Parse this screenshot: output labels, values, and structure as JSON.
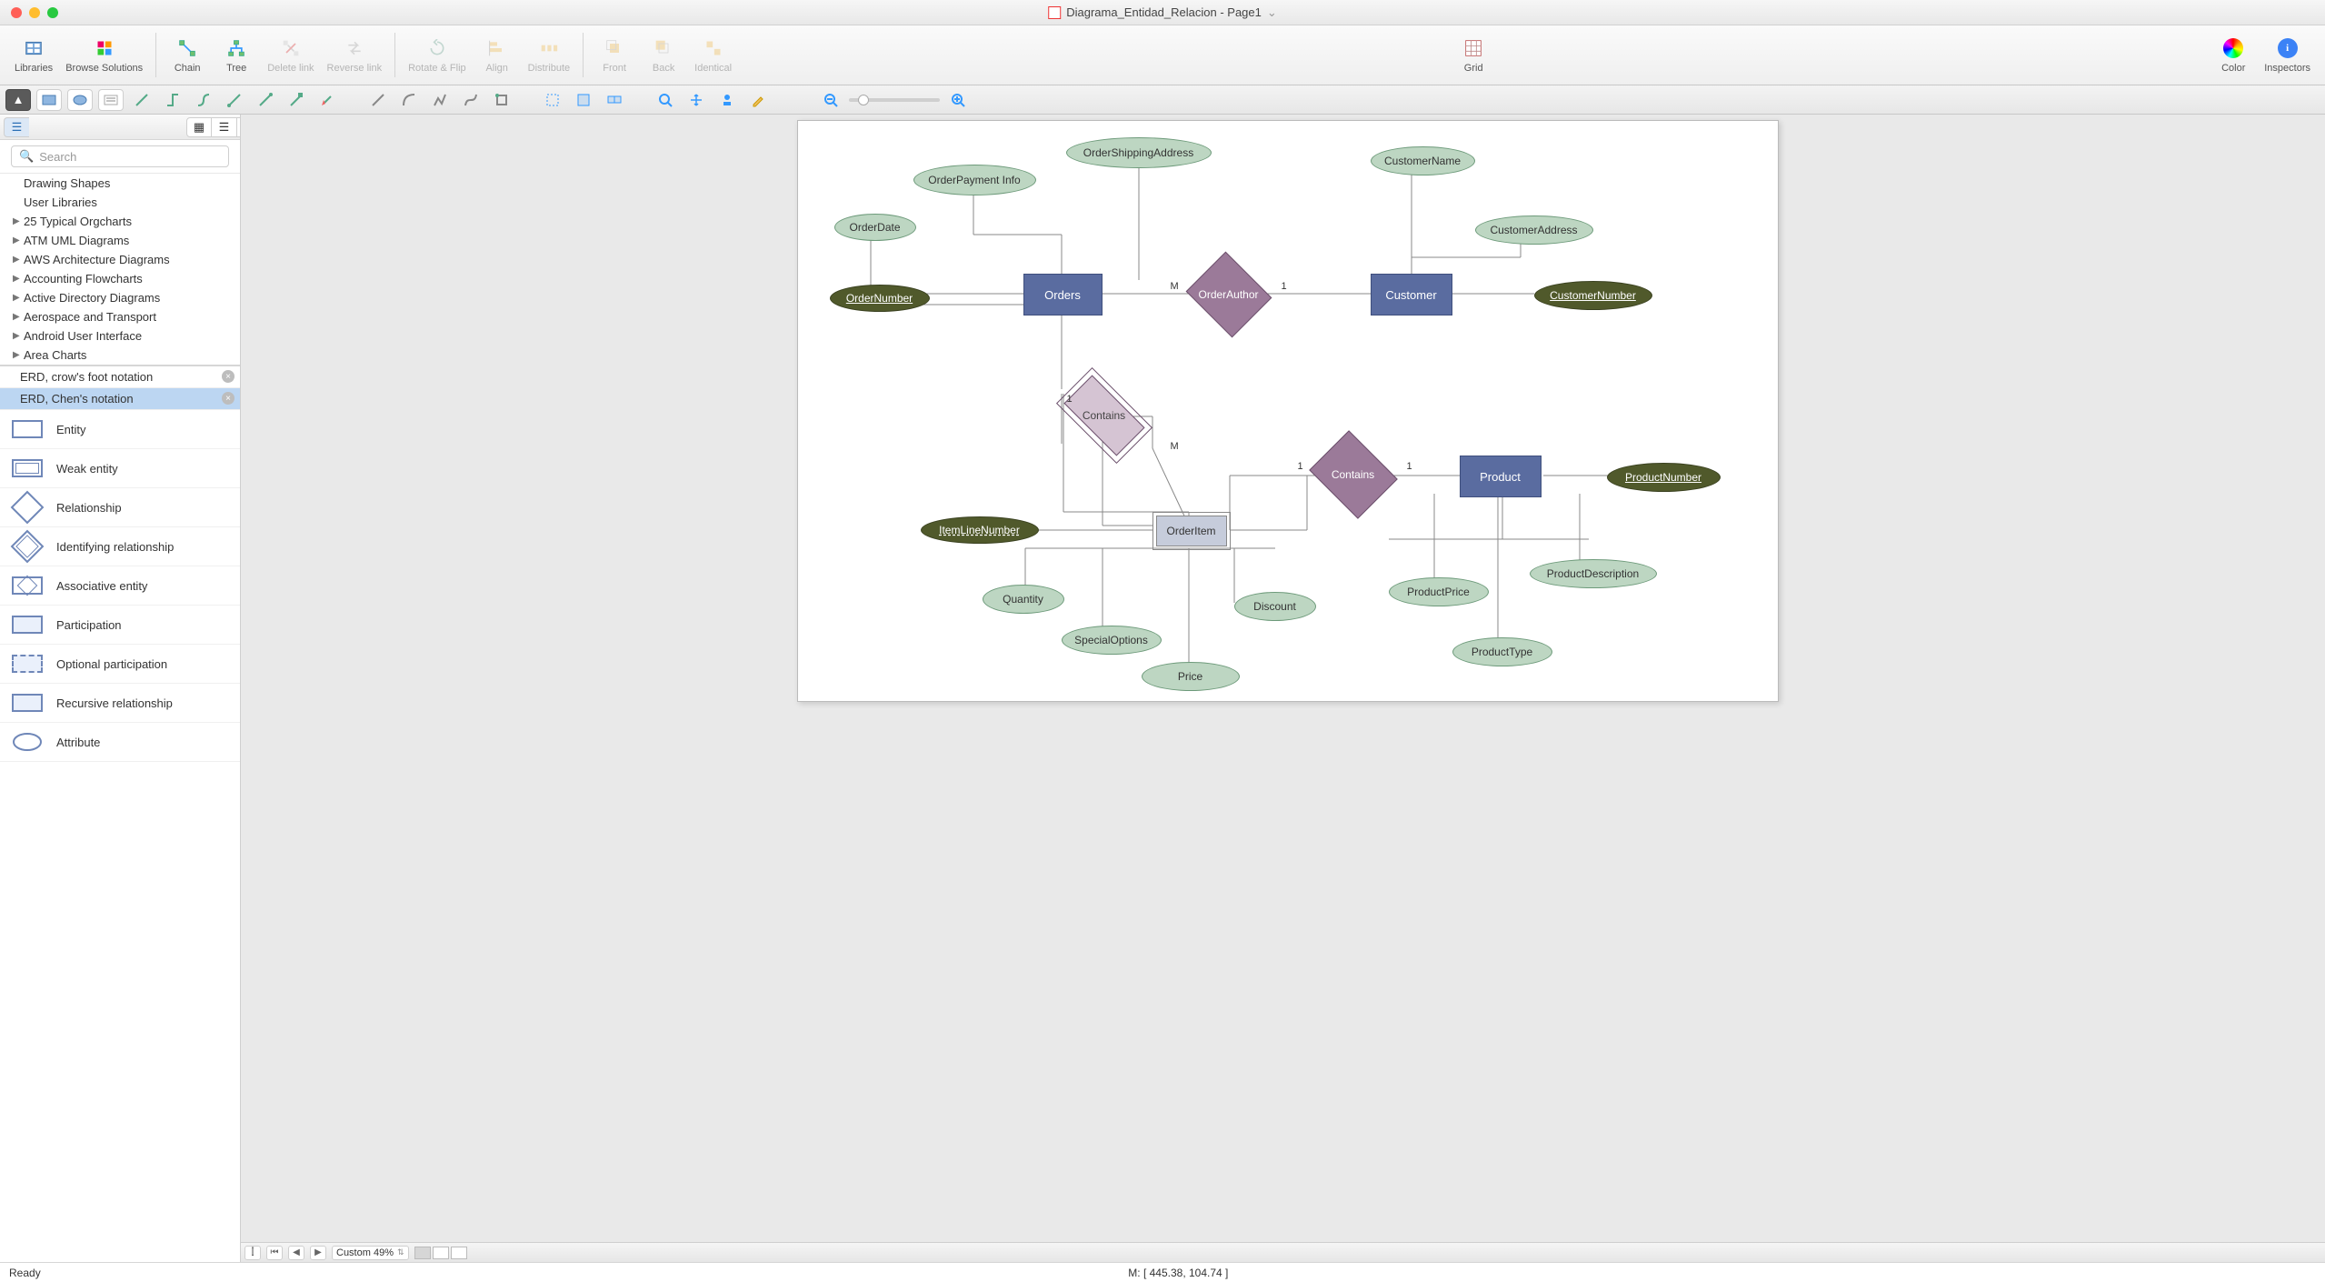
{
  "window": {
    "doc_title": "Diagrama_Entidad_Relacion - Page1"
  },
  "toolbar": {
    "libraries": "Libraries",
    "browse_solutions": "Browse Solutions",
    "chain": "Chain",
    "tree": "Tree",
    "delete_link": "Delete link",
    "reverse_link": "Reverse link",
    "rotate_flip": "Rotate & Flip",
    "align": "Align",
    "distribute": "Distribute",
    "front": "Front",
    "back": "Back",
    "identical": "Identical",
    "grid": "Grid",
    "color": "Color",
    "inspectors": "Inspectors"
  },
  "search": {
    "placeholder": "Search"
  },
  "tree": {
    "items": [
      {
        "label": "Drawing Shapes",
        "arrow": false
      },
      {
        "label": "User Libraries",
        "arrow": false
      },
      {
        "label": "25 Typical Orgcharts",
        "arrow": true
      },
      {
        "label": "ATM UML Diagrams",
        "arrow": true
      },
      {
        "label": "AWS Architecture Diagrams",
        "arrow": true
      },
      {
        "label": "Accounting Flowcharts",
        "arrow": true
      },
      {
        "label": "Active Directory Diagrams",
        "arrow": true
      },
      {
        "label": "Aerospace and Transport",
        "arrow": true
      },
      {
        "label": "Android User Interface",
        "arrow": true
      },
      {
        "label": "Area Charts",
        "arrow": true
      }
    ]
  },
  "open_libs": {
    "crow": "ERD, crow's foot notation",
    "chen": "ERD, Chen's notation"
  },
  "shapes": {
    "entity": "Entity",
    "weak_entity": "Weak entity",
    "relationship": "Relationship",
    "ident_rel": "Identifying relationship",
    "assoc_entity": "Associative entity",
    "participation": "Participation",
    "opt_participation": "Optional participation",
    "recursive_rel": "Recursive relationship",
    "attribute": "Attribute"
  },
  "erd": {
    "orders": "Orders",
    "order_number": "OrderNumber",
    "order_date": "OrderDate",
    "order_payment": "OrderPayment Info",
    "order_shipping": "OrderShippingAddress",
    "order_author": "OrderAuthor",
    "customer": "Customer",
    "customer_name": "CustomerName",
    "customer_address": "CustomerAddress",
    "customer_number": "CustomerNumber",
    "contains1": "Contains",
    "order_item": "OrderItem",
    "item_line_number": "ItemLineNumber",
    "quantity": "Quantity",
    "special_options": "SpecialOptions",
    "price": "Price",
    "discount": "Discount",
    "contains2": "Contains",
    "product": "Product",
    "product_number": "ProductNumber",
    "product_price": "ProductPrice",
    "product_description": "ProductDescription",
    "product_type": "ProductType",
    "card_M": "M",
    "card_1": "1"
  },
  "pagebar": {
    "zoom_label": "Custom 49%"
  },
  "status": {
    "ready": "Ready",
    "mouse": "M: [ 445.38, 104.74 ]"
  }
}
